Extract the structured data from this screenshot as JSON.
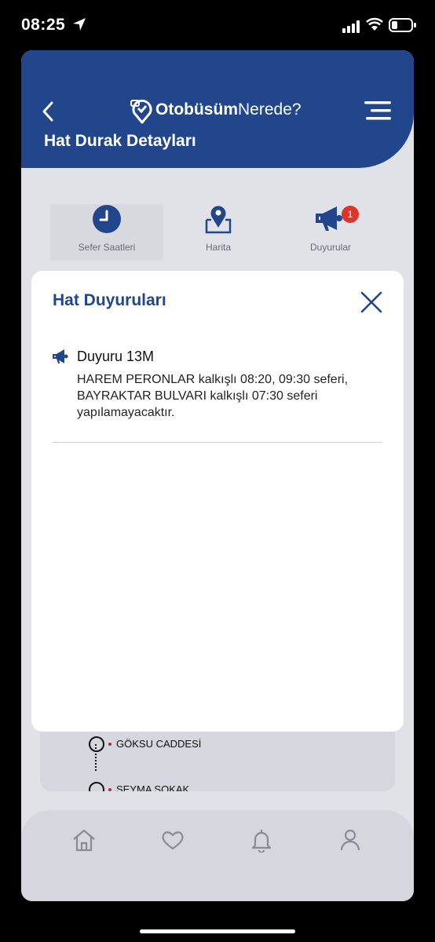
{
  "status_bar": {
    "time": "08:25"
  },
  "header": {
    "logo_bold": "Otobüsüm",
    "logo_light": "Nerede?",
    "title": "Hat Durak Detayları"
  },
  "tabs": [
    {
      "label": "Sefer Saatleri",
      "icon": "clock-icon",
      "active": true
    },
    {
      "label": "Harita",
      "icon": "map-pin-icon",
      "active": false
    },
    {
      "label": "Duyurular",
      "icon": "megaphone-icon",
      "active": false,
      "badge": "1"
    }
  ],
  "route": {
    "stops": [
      "GÖKSU CADDESİ",
      "ŞEYMA SOKAK"
    ]
  },
  "modal": {
    "title": "Hat Duyuruları",
    "announcement": {
      "title": "Duyuru 13M",
      "body": "HAREM PERONLAR kalkışlı 08:20, 09:30 seferi, BAYRAKTAR BULVARI kalkışlı 07:30 seferi yapılamayacaktır."
    }
  },
  "bottom_nav": [
    "home-icon",
    "heart-icon",
    "bell-icon",
    "user-icon"
  ],
  "colors": {
    "brand": "#21468c",
    "badge": "#e0342b",
    "background": "#e1e1e8"
  }
}
